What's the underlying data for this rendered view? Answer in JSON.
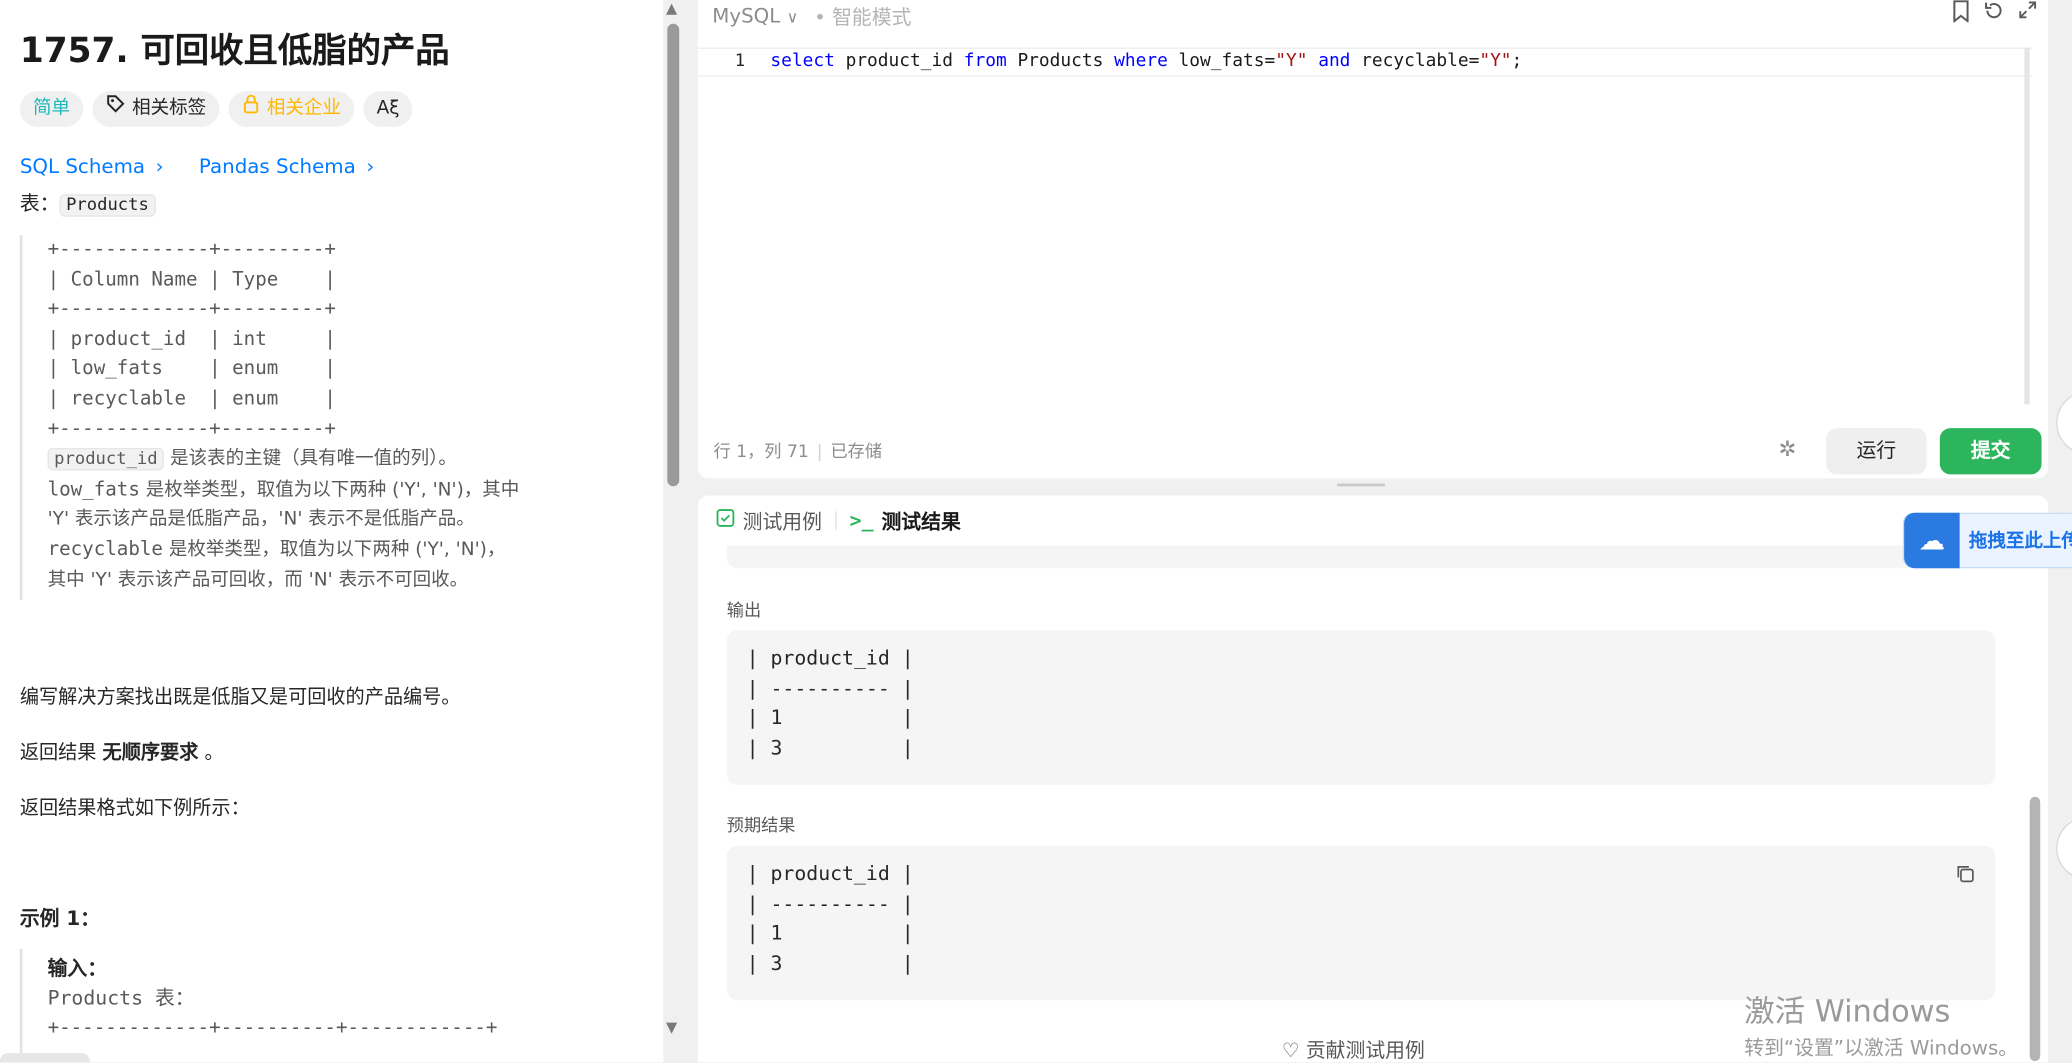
{
  "problem": {
    "title": "1757. 可回收且低脂的产品",
    "tags": {
      "difficulty": "简单",
      "related_tags": "相关标签",
      "companies": "相关企业",
      "font_icon": "Aξ"
    },
    "links": {
      "sql_schema": "SQL Schema",
      "pandas_schema": "Pandas Schema"
    },
    "table_label": "表：",
    "table_name": "Products",
    "schema_ascii": "+-------------+---------+\n| Column Name | Type    |\n+-------------+---------+\n| product_id  | int     |\n| low_fats    | enum    |\n| recyclable  | enum    |\n+-------------+---------+",
    "desc1_code": "product_id",
    "desc1_text": " 是该表的主键（具有唯一值的列）。",
    "desc2_code": "low_fats",
    "desc2_text": " 是枚举类型，取值为以下两种 ('Y', 'N')，其中",
    "desc3_text": "'Y' 表示该产品是低脂产品，'N' 表示不是低脂产品。",
    "desc4_code": "recyclable",
    "desc4_text": " 是枚举类型，取值为以下两种 ('Y', 'N')，",
    "desc5_text": "其中 'Y' 表示该产品可回收，而 'N' 表示不可回收。",
    "task": "编写解决方案找出既是低脂又是可回收的产品编号。",
    "order_prefix": "返回结果 ",
    "order_bold": "无顺序要求",
    "order_suffix": " 。",
    "format": "返回结果格式如下例所示：",
    "example_title": "示例 1：",
    "example_input_label": "输入：",
    "example_table": "Products 表：",
    "example_ascii": "+-------------+----------+------------+"
  },
  "editor": {
    "language": "MySQL",
    "mode": "智能模式",
    "line_number": "1",
    "code_kw1": "select",
    "code_t1": " product_id ",
    "code_kw2": "from",
    "code_t2": " Products ",
    "code_kw3": "where",
    "code_t3": " low_fats=",
    "code_s1": "\"Y\"",
    "code_t4": " ",
    "code_kw4": "and",
    "code_t5": " recyclable=",
    "code_s2": "\"Y\"",
    "code_t6": ";",
    "status_pos": "行 1，列 71",
    "status_saved": "已存储",
    "run_label": "运行",
    "submit_label": "提交"
  },
  "results": {
    "tab_testcase": "测试用例",
    "tab_result": "测试结果",
    "output_label": "输出",
    "output_text": "| product_id |\n| ---------- |\n| 1          |\n| 3          |",
    "expected_label": "预期结果",
    "expected_text": "| product_id |\n| ---------- |\n| 1          |\n| 3          |",
    "contribute": "贡献测试用例"
  },
  "overlay": {
    "upload_hint": "拖拽至此上传",
    "watermark_line1": "激活 Windows",
    "watermark_line2": "转到“设置”以激活 Windows。"
  },
  "colors": {
    "accent_blue": "#007aff",
    "submit_green": "#2db55d",
    "easy_teal": "#1cb8b8",
    "company_amber": "#ffb700"
  }
}
